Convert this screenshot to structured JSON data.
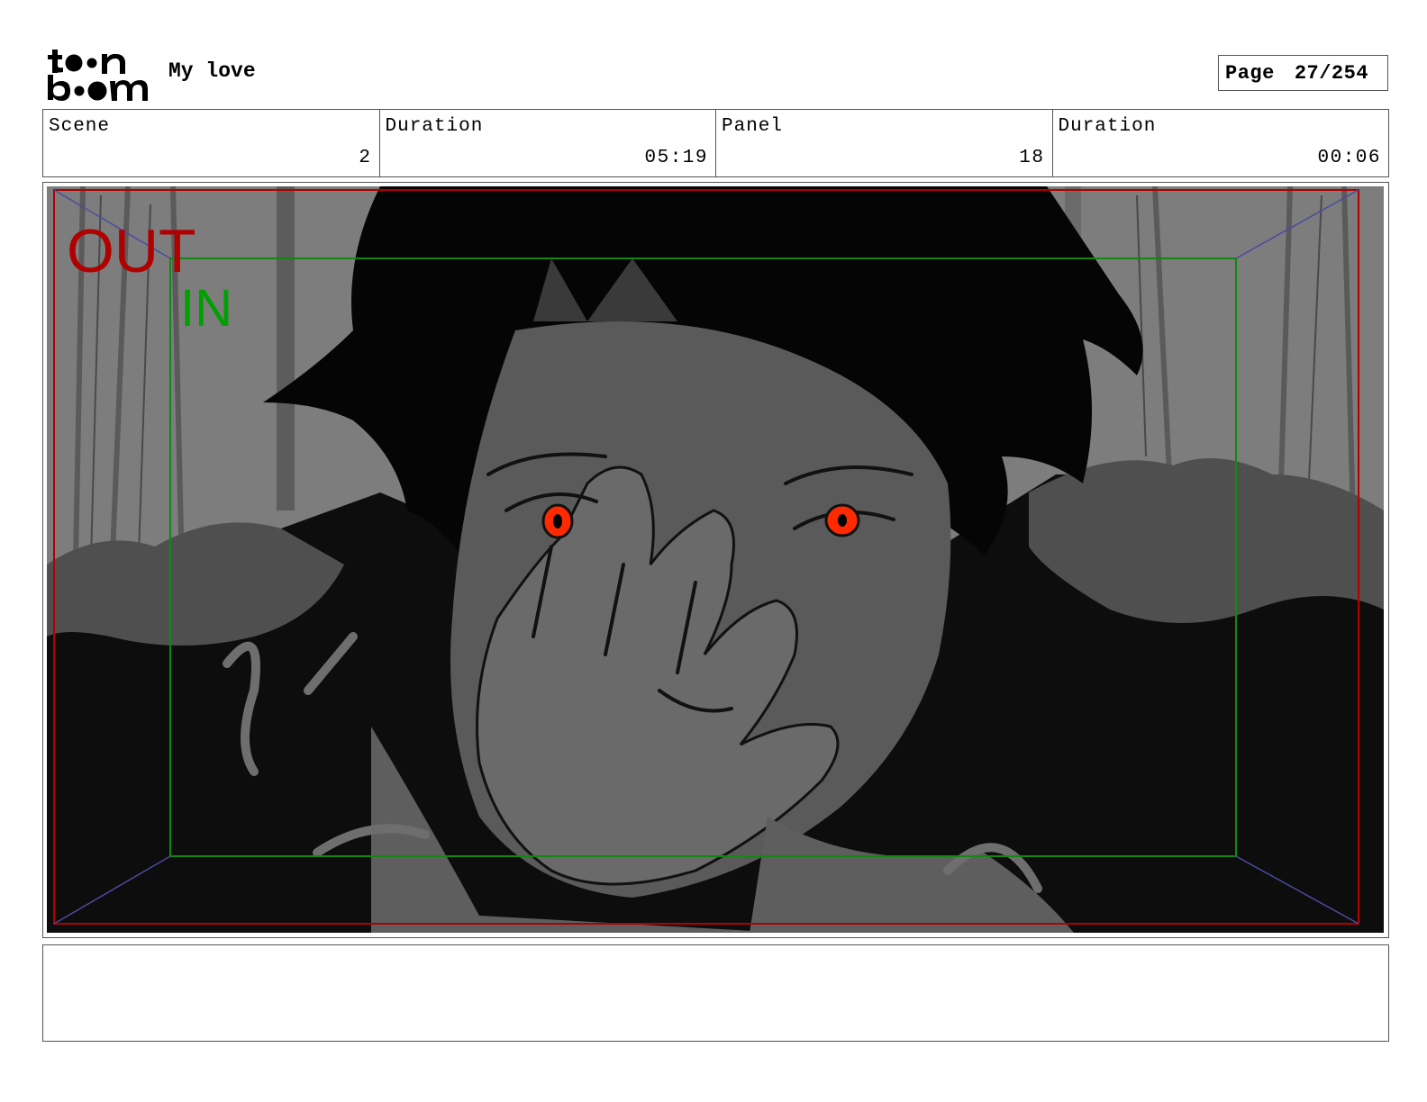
{
  "header": {
    "logo_top": "to●n",
    "logo_bottom": "b●●m",
    "project_title": "My love",
    "page_label": "Page",
    "page_number": "27/254"
  },
  "info": {
    "scene_label": "Scene",
    "scene_value": "2",
    "scene_duration_label": "Duration",
    "scene_duration_value": "05:19",
    "panel_label": "Panel",
    "panel_value": "18",
    "panel_duration_label": "Duration",
    "panel_duration_value": "00:06"
  },
  "frame": {
    "out_label": "OUT",
    "in_label": "IN",
    "out_color": "#b00000",
    "in_color": "#00a000"
  },
  "caption": {
    "text": ""
  }
}
